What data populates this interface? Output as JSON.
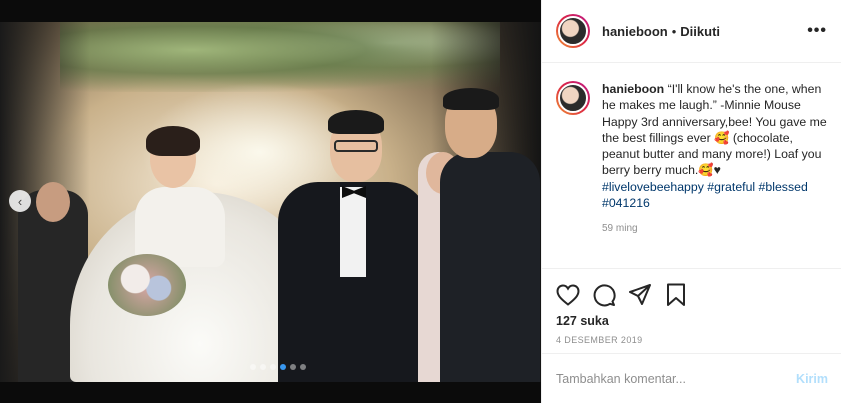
{
  "post": {
    "username": "hanieboon",
    "separator": "•",
    "follow_status": "Diikuti",
    "more_label": "•••"
  },
  "caption": {
    "username": "hanieboon",
    "text_line1": "“I'll know he's the one, when he makes me laugh.” -Minnie Mouse",
    "text_line2": "Happy 3rd anniversary,bee! You gave me the best fillings ever 🥰 (chocolate, peanut butter and many more!) Loaf you berry berry much.🥰♥",
    "hashtags": "#livelovebeehappy #grateful #blessed #041216",
    "time_ago": "59 ming"
  },
  "actions": {
    "icons": [
      "heart-icon",
      "comment-icon",
      "share-icon",
      "bookmark-icon"
    ]
  },
  "likes": "127 suka",
  "date": "4 DESEMBER 2019",
  "comment": {
    "placeholder": "Tambahkan komentar...",
    "send_label": "Kirim"
  },
  "media": {
    "prev_label": "‹",
    "slide_count": 6,
    "active_slide": 3
  },
  "colors": {
    "accent": "#3897f0",
    "send_disabled": "#b2dffc",
    "hashtag": "#00376b",
    "muted": "#8e8e8e"
  }
}
